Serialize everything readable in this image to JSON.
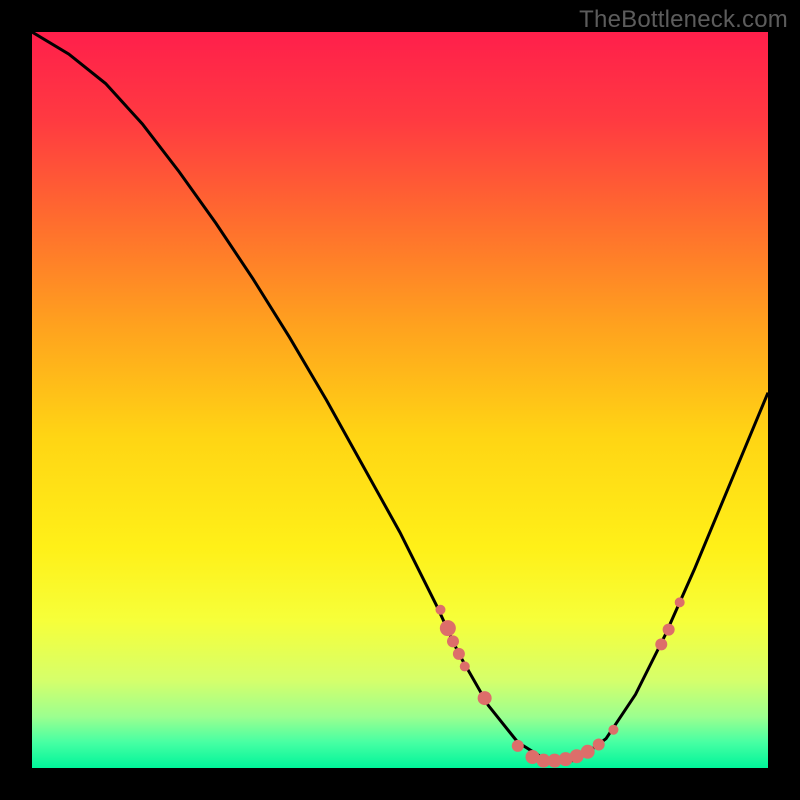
{
  "watermark": "TheBottleneck.com",
  "chart_data": {
    "type": "line",
    "title": "",
    "xlabel": "",
    "ylabel": "",
    "xlim": [
      0,
      100
    ],
    "ylim": [
      0,
      100
    ],
    "curve": {
      "name": "bottleneck-curve",
      "x": [
        0,
        5,
        10,
        15,
        20,
        25,
        30,
        35,
        40,
        45,
        50,
        55,
        58,
        62,
        66,
        70,
        74,
        78,
        82,
        86,
        90,
        95,
        100
      ],
      "y": [
        100,
        97,
        93,
        87.5,
        81,
        74,
        66.5,
        58.5,
        50,
        41,
        32,
        22,
        15.5,
        8.5,
        3.5,
        1,
        1,
        4,
        10,
        18,
        27,
        39,
        51
      ]
    },
    "markers": {
      "name": "highlight-points",
      "color": "#dd6e6a",
      "points": [
        {
          "x": 55.5,
          "y": 21.5,
          "r": 5
        },
        {
          "x": 56.5,
          "y": 19.0,
          "r": 8
        },
        {
          "x": 57.2,
          "y": 17.2,
          "r": 6
        },
        {
          "x": 58.0,
          "y": 15.5,
          "r": 6
        },
        {
          "x": 58.8,
          "y": 13.8,
          "r": 5
        },
        {
          "x": 61.5,
          "y": 9.5,
          "r": 7
        },
        {
          "x": 66.0,
          "y": 3.0,
          "r": 6
        },
        {
          "x": 68.0,
          "y": 1.5,
          "r": 7
        },
        {
          "x": 69.5,
          "y": 1.0,
          "r": 7
        },
        {
          "x": 71.0,
          "y": 1.0,
          "r": 7
        },
        {
          "x": 72.5,
          "y": 1.2,
          "r": 7
        },
        {
          "x": 74.0,
          "y": 1.6,
          "r": 7
        },
        {
          "x": 75.5,
          "y": 2.2,
          "r": 7
        },
        {
          "x": 77.0,
          "y": 3.2,
          "r": 6
        },
        {
          "x": 79.0,
          "y": 5.2,
          "r": 5
        },
        {
          "x": 85.5,
          "y": 16.8,
          "r": 6
        },
        {
          "x": 86.5,
          "y": 18.8,
          "r": 6
        },
        {
          "x": 88.0,
          "y": 22.5,
          "r": 5
        }
      ]
    },
    "gradient_stops": [
      {
        "offset": 0.0,
        "color": "#ff1f4b"
      },
      {
        "offset": 0.12,
        "color": "#ff3a41"
      },
      {
        "offset": 0.25,
        "color": "#ff6a2f"
      },
      {
        "offset": 0.4,
        "color": "#ffa21e"
      },
      {
        "offset": 0.55,
        "color": "#ffd514"
      },
      {
        "offset": 0.7,
        "color": "#fff018"
      },
      {
        "offset": 0.8,
        "color": "#f6ff3a"
      },
      {
        "offset": 0.88,
        "color": "#d6ff6a"
      },
      {
        "offset": 0.93,
        "color": "#9cff8f"
      },
      {
        "offset": 0.965,
        "color": "#47ffa3"
      },
      {
        "offset": 1.0,
        "color": "#00f59a"
      }
    ]
  }
}
